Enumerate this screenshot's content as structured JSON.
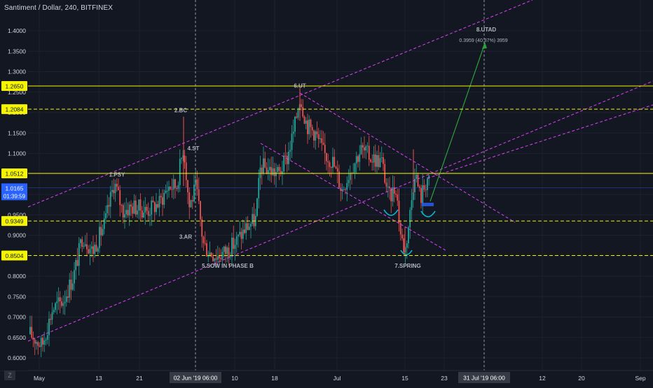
{
  "header": {
    "title": "Santiment / Dollar, 240, BITFINEX"
  },
  "branding": {
    "logo_text": "Z"
  },
  "colors": {
    "background": "#131722",
    "grid": "#1e2230",
    "axis_text": "#d1d4dc",
    "candle_up": "#26a69a",
    "candle_down": "#ef5350",
    "level_line": "#f5f500",
    "level_label_bg": "#f5f500",
    "channel_line": "#e040fb",
    "projection_arrow": "#2e9e3a",
    "annotation_text": "#b2b5be",
    "arc_marker": "#00bcd4",
    "current_price_bg": "#2962ff",
    "cursor_line": "#9598a1",
    "cursor_label_bg": "#363a45"
  },
  "chart_data": {
    "type": "candlestick",
    "title": "Santiment / Dollar, 240, BITFINEX",
    "ylim": [
      0.585,
      1.485
    ],
    "y_ticks": [
      1.4,
      1.35,
      1.3,
      1.25,
      1.2,
      1.15,
      1.1,
      1.05,
      1.0,
      0.95,
      0.9,
      0.85,
      0.8,
      0.75,
      0.7,
      0.65,
      0.6
    ],
    "x_ticks": [
      "May",
      "13",
      "21",
      "02 Jun '19",
      "10",
      "18",
      "Jul",
      "15",
      "23",
      "31 Jul '19",
      "12",
      "20",
      "Sep"
    ],
    "horizontal_levels": [
      {
        "label": "1.2650",
        "value": 1.265,
        "style": "solid"
      },
      {
        "label": "1.2084",
        "value": 1.2084,
        "style": "dashed"
      },
      {
        "label": "1.0512",
        "value": 1.0512,
        "style": "solid"
      },
      {
        "label": "0.9349",
        "value": 0.9349,
        "style": "dashed"
      },
      {
        "label": "0.8504",
        "value": 0.8504,
        "style": "dashed"
      }
    ],
    "current_price": {
      "value": "1.0165",
      "countdown": "01:39:59"
    },
    "crosshair": {
      "time_label": "02 Jun '19   06:00",
      "second_time_label": "31 Jul '19   06:00"
    },
    "wyckoff_annotations": [
      {
        "label": "1.PSY",
        "price": 1.049
      },
      {
        "label": "2.BC",
        "price": 1.206
      },
      {
        "label": "3.AR",
        "price": 0.897
      },
      {
        "label": "4.ST",
        "price": 1.113
      },
      {
        "label": "5.SOW IN PHASE B",
        "price": 0.826
      },
      {
        "label": "6.UT",
        "price": 1.266
      },
      {
        "label": "7.SPRING",
        "price": 0.826
      },
      {
        "label": "8.UTAD",
        "price": 1.403
      }
    ],
    "measure_label": "0.3959 (40.37%) 3959",
    "candles_ohlc": []
  }
}
